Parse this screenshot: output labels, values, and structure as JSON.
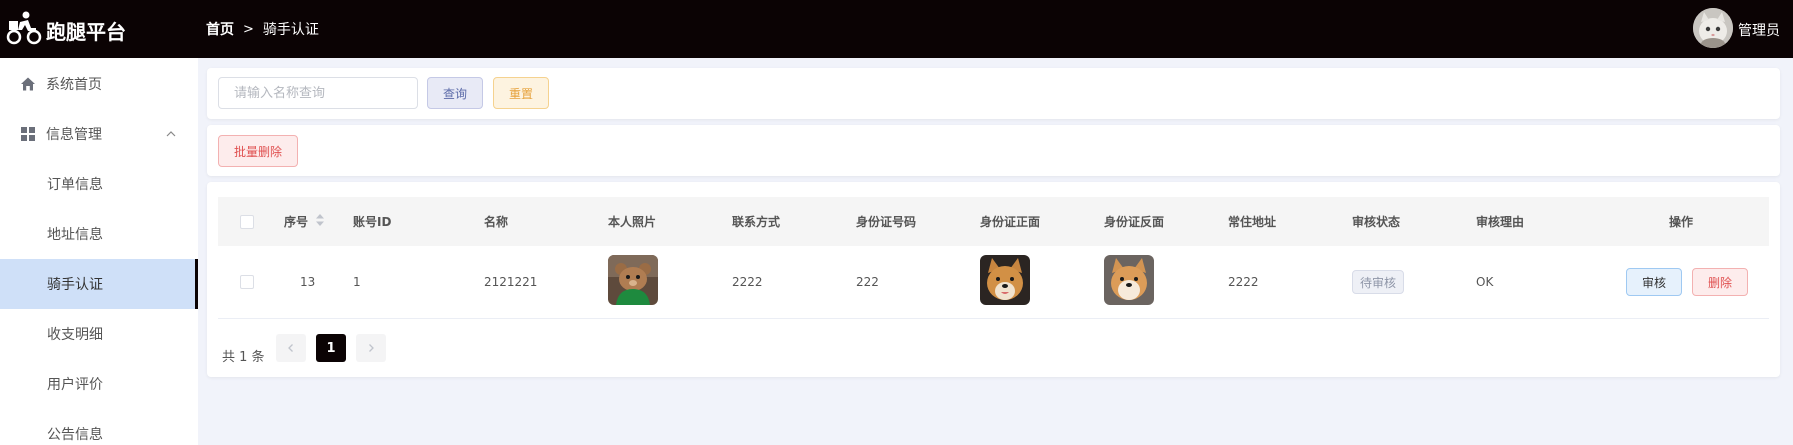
{
  "header": {
    "brand": "跑腿平台",
    "breadcrumb_home": "首页",
    "breadcrumb_sep": ">",
    "breadcrumb_current": "骑手认证",
    "user_name": "管理员"
  },
  "sidebar": {
    "items": [
      {
        "label": "系统首页",
        "icon": "home-icon"
      },
      {
        "label": "信息管理",
        "icon": "grid-icon"
      },
      {
        "label": "订单信息"
      },
      {
        "label": "地址信息"
      },
      {
        "label": "骑手认证"
      },
      {
        "label": "收支明细"
      },
      {
        "label": "用户评价"
      },
      {
        "label": "公告信息"
      }
    ],
    "active": "骑手认证",
    "accent_color": "#cfe0f8"
  },
  "search": {
    "placeholder": "请输入名称查询",
    "value": "",
    "query_label": "查询",
    "reset_label": "重置"
  },
  "toolbar": {
    "batch_delete_label": "批量删除"
  },
  "table": {
    "columns": [
      "序号",
      "账号ID",
      "名称",
      "本人照片",
      "联系方式",
      "身份证号码",
      "身份证正面",
      "身份证反面",
      "常住地址",
      "审核状态",
      "审核理由",
      "操作"
    ],
    "rows": [
      {
        "id": "13",
        "account_id": "1",
        "name": "2121221",
        "photo": "teddy-bear-photo",
        "contact": "2222",
        "id_number": "222",
        "id_front": "shiba-dog-photo",
        "id_back": "shiba-dog-photo",
        "address": "2222",
        "status": "待审核",
        "reason": "OK",
        "audit_label": "审核",
        "delete_label": "删除"
      }
    ]
  },
  "pagination": {
    "total_label": "共 1 条",
    "current_page": "1",
    "prev_icon": "chevron-left-icon",
    "next_icon": "chevron-right-icon"
  },
  "colors": {
    "header_bg": "#0b0304",
    "page_bg": "#f1f3fa",
    "danger": "#e05050",
    "warning": "#e6a23c"
  }
}
